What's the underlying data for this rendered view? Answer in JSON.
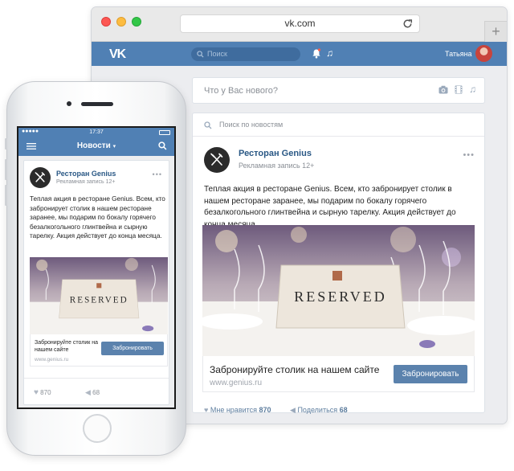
{
  "browser": {
    "url": "vk.com",
    "plus_label": "+"
  },
  "vk_header": {
    "logo": "VK",
    "search_placeholder": "Поиск",
    "user_name": "Татьяна"
  },
  "composer": {
    "placeholder": "Что у Вас нового?"
  },
  "feed": {
    "search_placeholder": "Поиск по новостям"
  },
  "post": {
    "author": "Ресторан Genius",
    "subtitle": "Рекламная запись 12+",
    "more": "•••",
    "text": "Теплая акция в ресторане Genius. Всем, кто забронирует столик в нашем ресторане заранее, мы подарим по бокалу горячего безалкогольного глинтвейна и сырную тарелку. Акция действует до конца месяца.",
    "sign_text": "RESERVED",
    "link_title": "Забронируйте столик на нашем сайте",
    "link_url": "www.genius.ru",
    "button_label": "Забронировать",
    "likes_label": "Мне нравится",
    "likes_count": "870",
    "shares_label": "Поделиться",
    "shares_count": "68"
  },
  "mobile": {
    "time": "17:37",
    "nav_title": "Новости",
    "likes": "870",
    "shares": "68"
  },
  "colors": {
    "vk_blue": "#5080b4",
    "link_blue": "#2a5885",
    "button": "#5b82ad"
  }
}
